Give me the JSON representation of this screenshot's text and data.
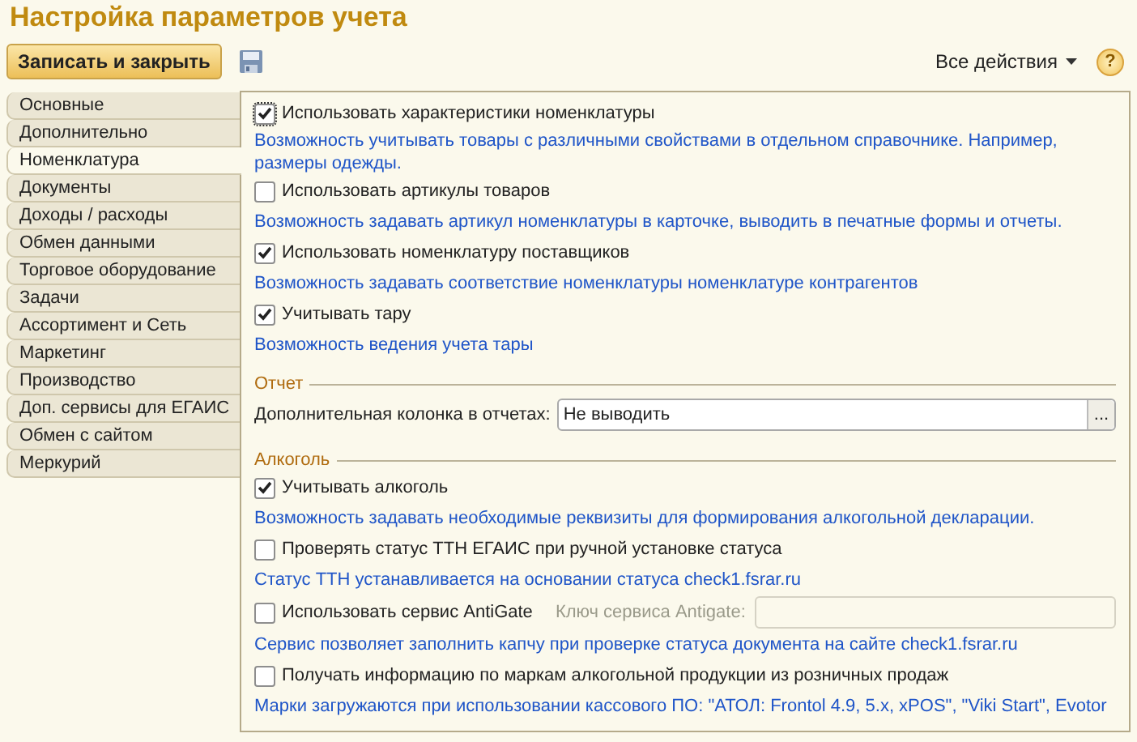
{
  "window": {
    "title": "Настройка параметров учета"
  },
  "toolbar": {
    "save_close": "Записать и закрыть",
    "all_actions": "Все действия",
    "help": "?"
  },
  "tabs": [
    {
      "label": "Основные",
      "selected": false
    },
    {
      "label": "Дополнительно",
      "selected": false
    },
    {
      "label": "Номенклатура",
      "selected": true
    },
    {
      "label": "Документы",
      "selected": false
    },
    {
      "label": "Доходы / расходы",
      "selected": false
    },
    {
      "label": "Обмен данными",
      "selected": false
    },
    {
      "label": "Торговое оборудование",
      "selected": false
    },
    {
      "label": "Задачи",
      "selected": false
    },
    {
      "label": "Ассортимент и Сеть",
      "selected": false
    },
    {
      "label": "Маркетинг",
      "selected": false
    },
    {
      "label": "Производство",
      "selected": false
    },
    {
      "label": "Доп. сервисы для ЕГАИС",
      "selected": false
    },
    {
      "label": "Обмен с сайтом",
      "selected": false
    },
    {
      "label": "Меркурий",
      "selected": false
    }
  ],
  "items": [
    {
      "kind": "checkbox",
      "label": "Использовать характеристики номенклатуры",
      "checked": true,
      "focused": true
    },
    {
      "kind": "hint",
      "text": "Возможность учитывать товары с различными свойствами в отдельном справочнике. Например, размеры одежды."
    },
    {
      "kind": "checkbox",
      "label": "Использовать артикулы товаров",
      "checked": false
    },
    {
      "kind": "hint",
      "text": "Возможность задавать артикул номенклатуры в карточке, выводить в печатные формы и отчеты."
    },
    {
      "kind": "checkbox",
      "label": "Использовать номенклатуру поставщиков",
      "checked": true
    },
    {
      "kind": "hint",
      "text": "Возможность задавать соответствие номенклатуры номенклатуре контрагентов"
    },
    {
      "kind": "checkbox",
      "label": "Учитывать тару",
      "checked": true
    },
    {
      "kind": "hint",
      "text": "Возможность ведения учета тары"
    },
    {
      "kind": "section",
      "title": "Отчет"
    },
    {
      "kind": "field",
      "label": "Дополнительная колонка в отчетах:",
      "value": "Не выводить",
      "button": "..."
    },
    {
      "kind": "section",
      "title": "Алкоголь"
    },
    {
      "kind": "checkbox",
      "label": "Учитывать алкоголь",
      "checked": true
    },
    {
      "kind": "hint",
      "text": "Возможность задавать необходимые реквизиты для формирования алкогольной декларации."
    },
    {
      "kind": "checkbox",
      "label": "Проверять статус ТТН ЕГАИС при ручной установке статуса",
      "checked": false
    },
    {
      "kind": "hint",
      "text": "Статус ТТН устанавливается на основании статуса check1.fsrar.ru"
    },
    {
      "kind": "checkbox",
      "label": "Использовать сервис AntiGate",
      "checked": false,
      "key_label": "Ключ сервиса Antigate:",
      "key_disabled": true
    },
    {
      "kind": "hint",
      "text": "Сервис позволяет заполнить капчу при проверке статуса документа на сайте check1.fsrar.ru"
    },
    {
      "kind": "checkbox",
      "label": "Получать информацию по маркам алкогольной продукции из розничных продаж",
      "checked": false
    },
    {
      "kind": "hint",
      "text": "Марки загружаются при использовании кассового ПО: \"АТОЛ: Frontol 4.9, 5.x, xPOS\", \"Viki Start\", Evotor"
    }
  ]
}
